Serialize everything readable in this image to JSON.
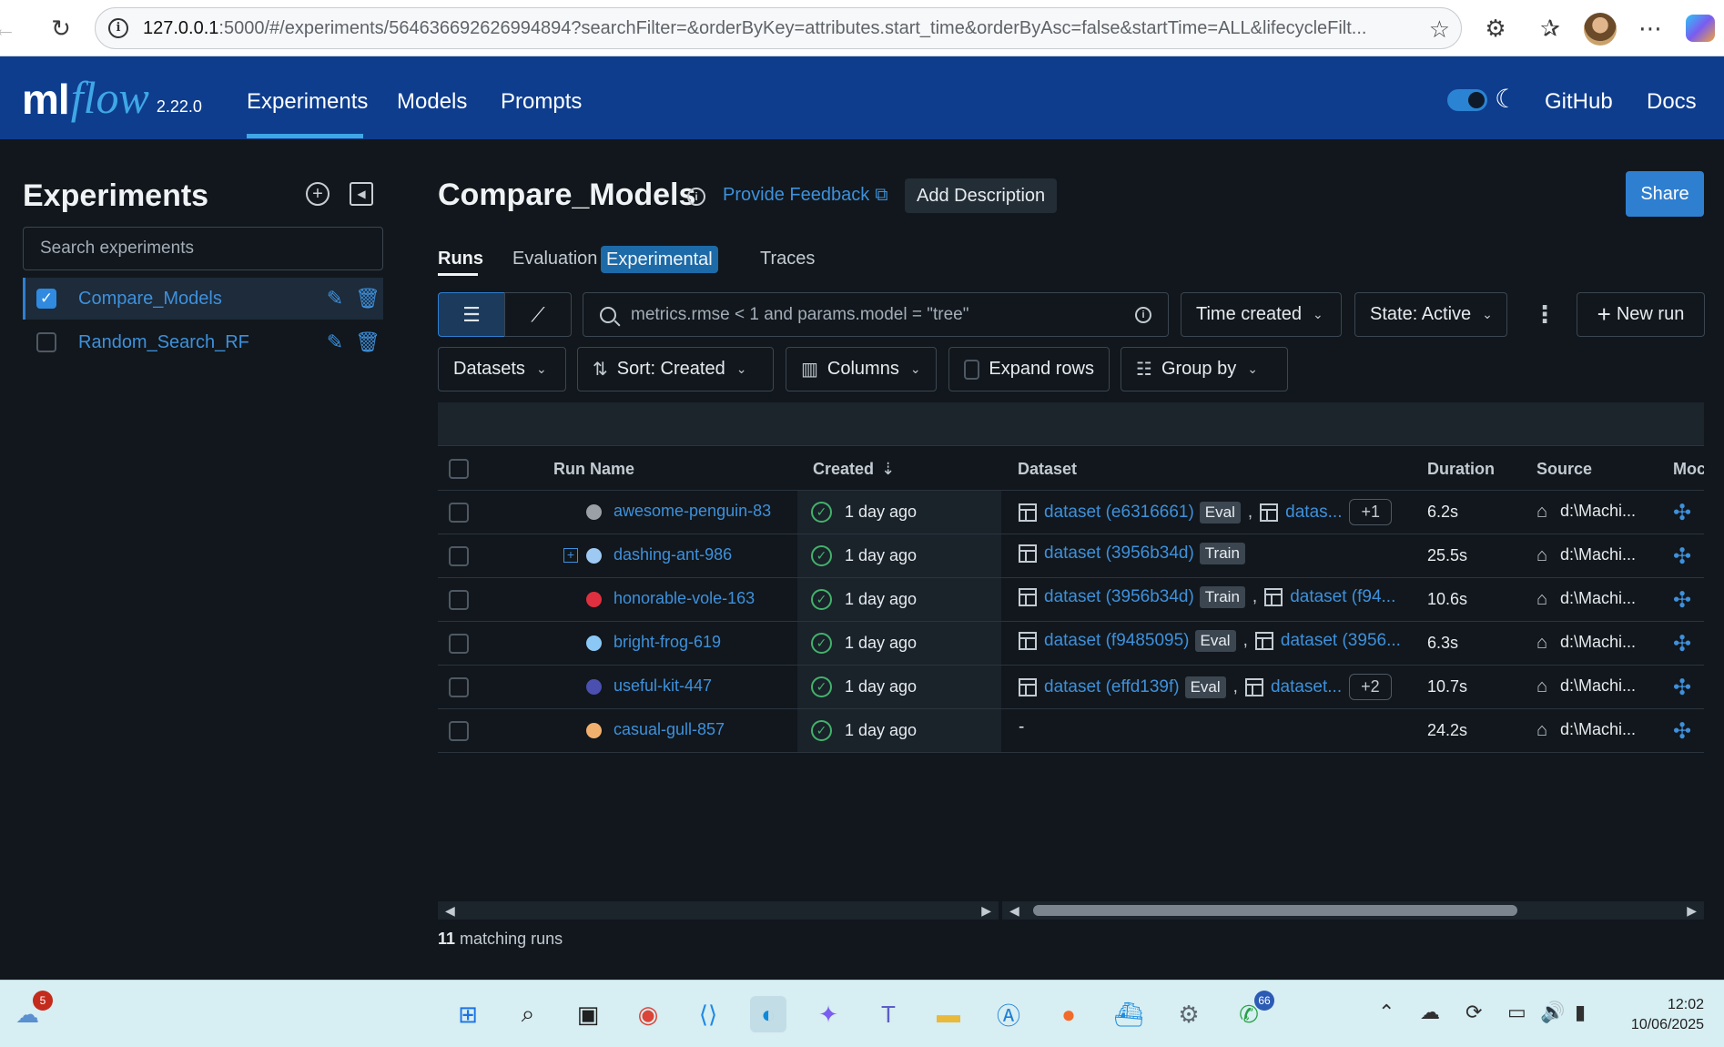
{
  "browser": {
    "url_host": "127.0.0.1",
    "url_rest": ":5000/#/experiments/564636692626994894?searchFilter=&orderByKey=attributes.start_time&orderByAsc=false&startTime=ALL&lifecycleFilt..."
  },
  "header": {
    "logo_ml": "ml",
    "logo_flow": "flow",
    "version": "2.22.0",
    "nav": [
      "Experiments",
      "Models",
      "Prompts"
    ],
    "right_links": [
      "GitHub",
      "Docs"
    ]
  },
  "sidebar": {
    "title": "Experiments",
    "search_placeholder": "Search experiments",
    "experiments": [
      {
        "name": "Compare_Models",
        "checked": true
      },
      {
        "name": "Random_Search_RF",
        "checked": false
      }
    ]
  },
  "main": {
    "title": "Compare_Models",
    "feedback": "Provide Feedback",
    "add_description": "Add Description",
    "share": "Share",
    "tabs": [
      "Runs",
      "Evaluation",
      "Traces"
    ],
    "tab_tag": "Experimental",
    "filter_value": "metrics.rmse < 1 and params.model = \"tree\"",
    "time_created": "Time created",
    "state": "State: Active",
    "new_run": "New run",
    "datasets": "Datasets",
    "sort": "Sort: Created",
    "columns": "Columns",
    "expand_rows": "Expand rows",
    "group_by": "Group by"
  },
  "table": {
    "headers": [
      "Run Name",
      "Created",
      "Dataset",
      "Duration",
      "Source",
      "Moc"
    ],
    "rows": [
      {
        "name": "awesome-penguin-83",
        "color": "#9aa0a6",
        "created": "1 day ago",
        "ds1": "dataset (e6316661)",
        "tag1": "Eval",
        "ds2": "datas...",
        "more": "+1",
        "duration": "6.2s",
        "source": "d:\\Machi..."
      },
      {
        "name": "dashing-ant-986",
        "color": "#9ec9f2",
        "created": "1 day ago",
        "ds1": "dataset (3956b34d)",
        "tag1": "Train",
        "ds2": "",
        "more": "",
        "duration": "25.5s",
        "source": "d:\\Machi..."
      },
      {
        "name": "honorable-vole-163",
        "color": "#e0303f",
        "created": "1 day ago",
        "ds1": "dataset (3956b34d)",
        "tag1": "Train",
        "ds2": "dataset (f94...",
        "more": "",
        "duration": "10.6s",
        "source": "d:\\Machi..."
      },
      {
        "name": "bright-frog-619",
        "color": "#8cc8f5",
        "created": "1 day ago",
        "ds1": "dataset (f9485095)",
        "tag1": "Eval",
        "ds2": "dataset (3956...",
        "more": "",
        "duration": "6.3s",
        "source": "d:\\Machi..."
      },
      {
        "name": "useful-kit-447",
        "color": "#4a4fb0",
        "created": "1 day ago",
        "ds1": "dataset (effd139f)",
        "tag1": "Eval",
        "ds2": "dataset...",
        "more": "+2",
        "duration": "10.7s",
        "source": "d:\\Machi..."
      },
      {
        "name": "casual-gull-857",
        "color": "#f2b06f",
        "created": "1 day ago",
        "ds1": "-",
        "tag1": "",
        "ds2": "",
        "more": "",
        "duration": "24.2s",
        "source": "d:\\Machi..."
      }
    ],
    "matching_count": "11",
    "matching_label": "matching runs"
  },
  "taskbar": {
    "weather_badge": "5",
    "whatsapp_badge": "66",
    "time": "12:02",
    "date": "10/06/2025"
  }
}
